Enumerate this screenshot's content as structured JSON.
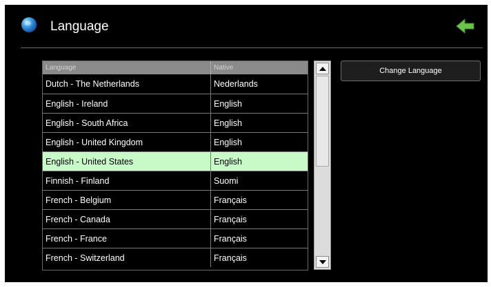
{
  "header": {
    "title": "Language",
    "globe_icon": "globe-icon",
    "back_icon": "green-back-arrow-icon"
  },
  "table": {
    "columns": [
      "Language",
      "Native"
    ],
    "rows": [
      {
        "language": "Dutch - The Netherlands",
        "native": "Nederlands",
        "selected": false
      },
      {
        "language": "English - Ireland",
        "native": "English",
        "selected": false
      },
      {
        "language": "English - South Africa",
        "native": "English",
        "selected": false
      },
      {
        "language": "English - United Kingdom",
        "native": "English",
        "selected": false
      },
      {
        "language": "English - United States",
        "native": "English",
        "selected": true
      },
      {
        "language": "Finnish - Finland",
        "native": "Suomi",
        "selected": false
      },
      {
        "language": "French - Belgium",
        "native": "Français",
        "selected": false
      },
      {
        "language": "French - Canada",
        "native": "Français",
        "selected": false
      },
      {
        "language": "French - France",
        "native": "Français",
        "selected": false
      },
      {
        "language": "French - Switzerland",
        "native": "Français",
        "selected": false
      }
    ]
  },
  "actions": {
    "change_language_label": "Change Language"
  },
  "colors": {
    "background": "#000000",
    "selected_row": "#c8fac8",
    "header_row": "#8a8a8a",
    "back_arrow": "#6cc24a"
  }
}
